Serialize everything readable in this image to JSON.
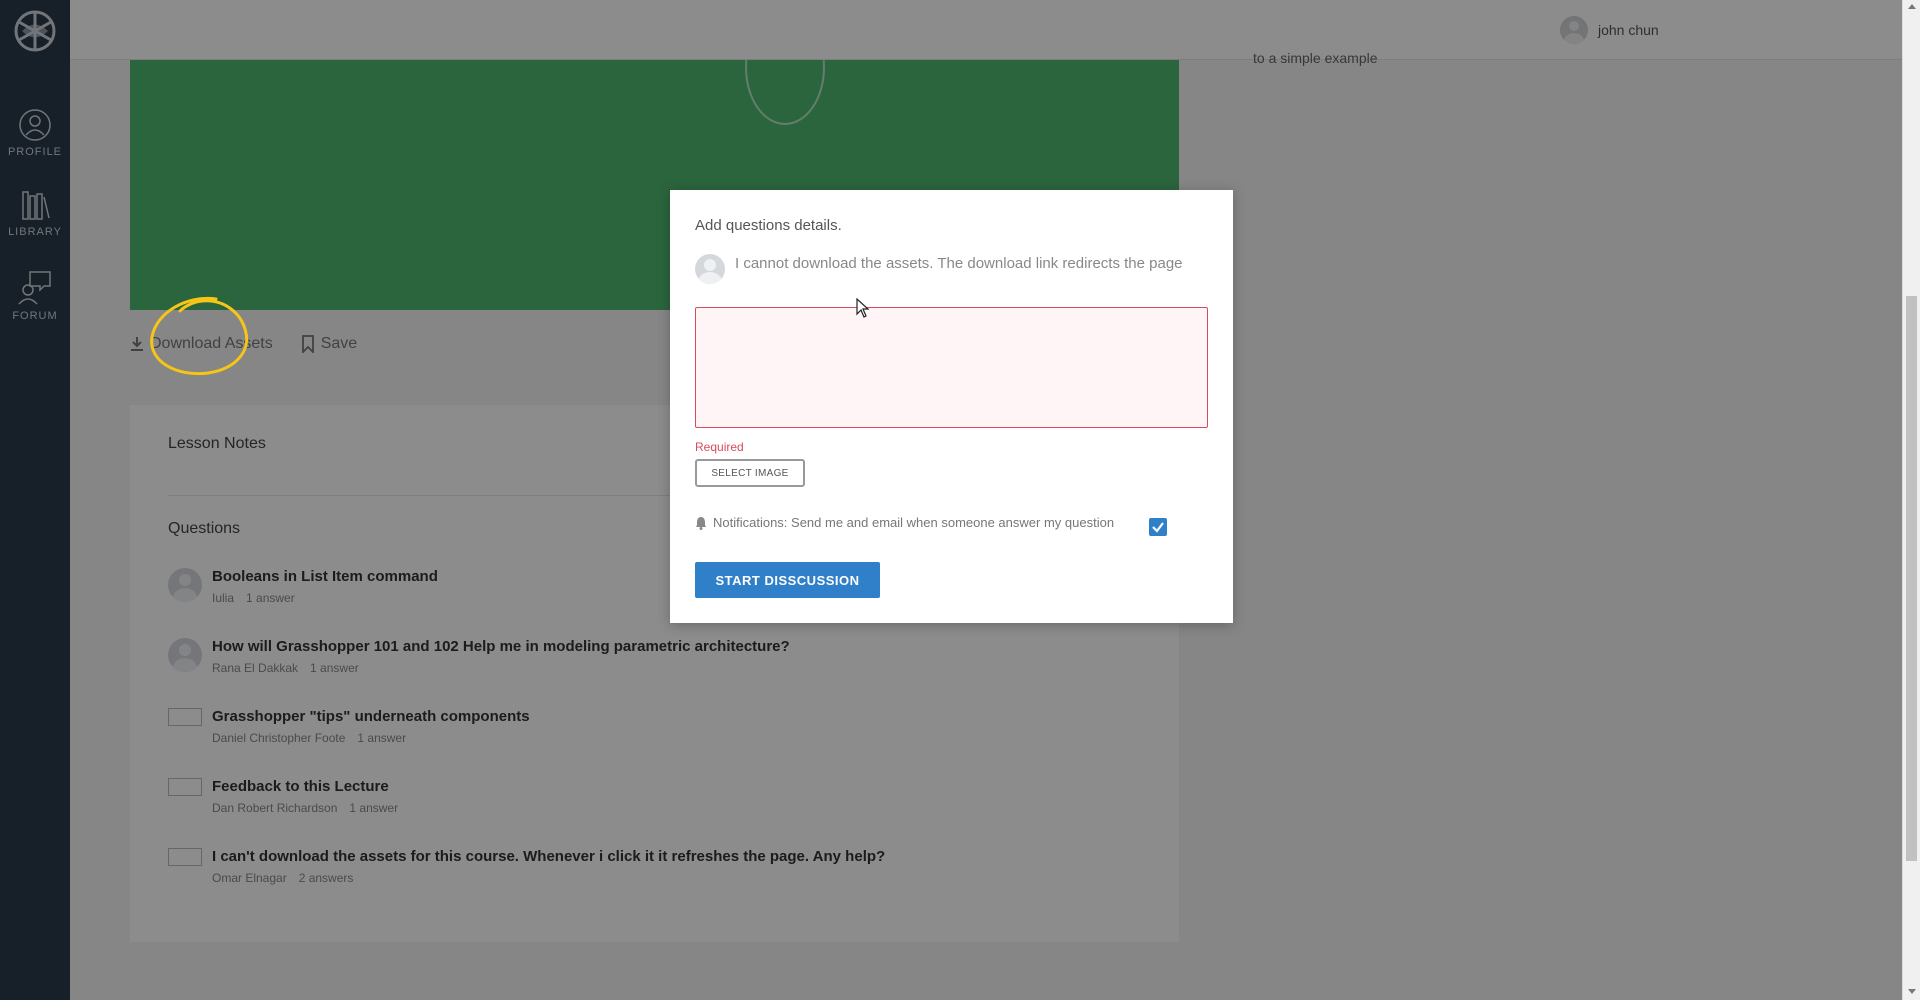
{
  "sidebar": {
    "items": [
      {
        "label": "PROFILE",
        "icon": "user-icon"
      },
      {
        "label": "LIBRARY",
        "icon": "books-icon"
      },
      {
        "label": "FORUM",
        "icon": "chat-icon"
      }
    ]
  },
  "header": {
    "user_name": "john chun"
  },
  "side_text": "to a simple example",
  "actions": {
    "download_label": "Download Assets",
    "save_label": "Save"
  },
  "lesson": {
    "notes_title": "Lesson Notes",
    "questions_title": "Questions"
  },
  "questions": [
    {
      "title": "Booleans in List Item command",
      "author": "Iulia",
      "answers": "1 answer",
      "avatar": "default"
    },
    {
      "title": "How will Grasshopper 101 and 102 Help me in modeling parametric architecture?",
      "author": "Rana El Dakkak",
      "answers": "1 answer",
      "avatar": "default"
    },
    {
      "title": "Grasshopper \"tips\" underneath components",
      "author": "Daniel Christopher Foote",
      "answers": "1 answer",
      "avatar": "broken"
    },
    {
      "title": "Feedback to this Lecture",
      "author": "Dan Robert Richardson",
      "answers": "1 answer",
      "avatar": "broken"
    },
    {
      "title": "I can't download the assets for this course. Whenever i click it it refreshes the page. Any help?",
      "author": "Omar Elnagar",
      "answers": "2 answers",
      "avatar": "broken"
    }
  ],
  "modal": {
    "title": "Add questions details.",
    "question_text": "I cannot download the assets. The download link redirects the page",
    "details_value": "",
    "required_text": "Required",
    "select_image_label": "SELECT IMAGE",
    "notification_text": "Notifications: Send me and email when someone answer my question",
    "notification_checked": true,
    "start_button_label": "START DISSCUSSION"
  },
  "colors": {
    "sidebar_bg": "#2b3a4a",
    "video_green": "#4fb86f",
    "accent_blue": "#2f80c8",
    "error_red": "#d84b5c",
    "highlight_yellow": "#f5c518"
  }
}
